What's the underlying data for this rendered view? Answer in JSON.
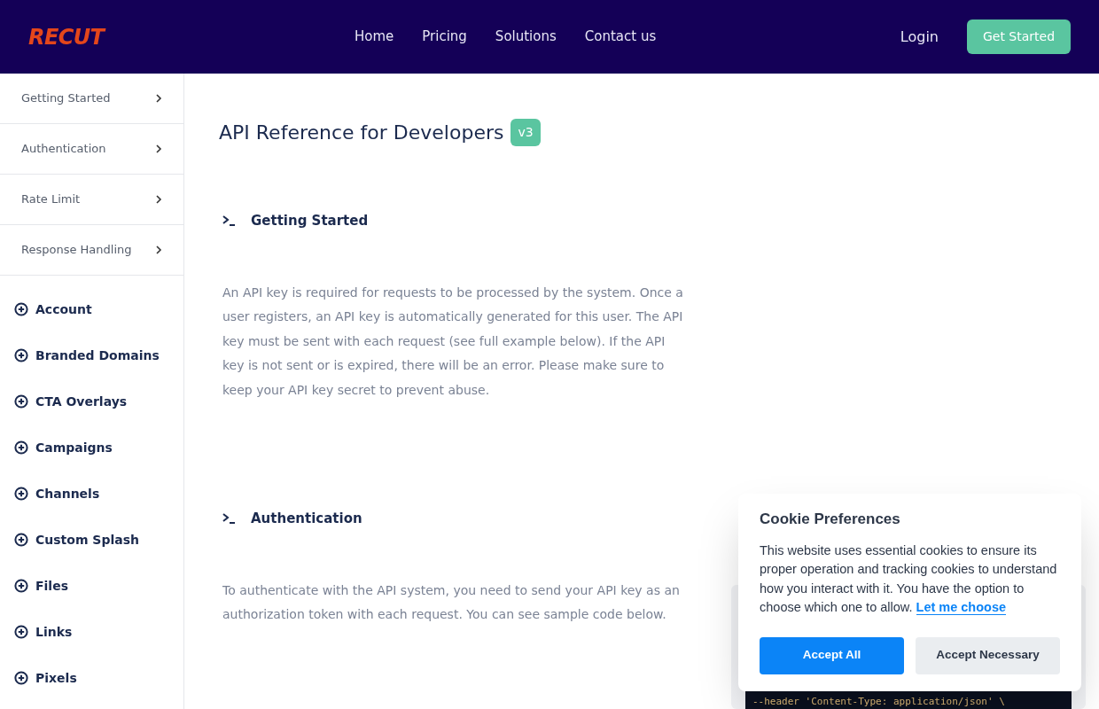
{
  "header": {
    "logo": "RECUT",
    "nav": [
      "Home",
      "Pricing",
      "Solutions",
      "Contact us"
    ],
    "login": "Login",
    "cta": "Get Started"
  },
  "sidebar": {
    "guides": [
      "Getting Started",
      "Authentication",
      "Rate Limit",
      "Response Handling"
    ],
    "sections": [
      "Account",
      "Branded Domains",
      "CTA Overlays",
      "Campaigns",
      "Channels",
      "Custom Splash",
      "Files",
      "Links",
      "Pixels"
    ]
  },
  "page": {
    "title": "API Reference for Developers",
    "badge": "v3",
    "sections": [
      {
        "heading": "Getting Started",
        "text": "An API key is required for requests to be processed by the system. Once a user registers, an API key is automatically generated for this user. The API key must be sent with each request (see full example below). If the API key is not sent or is expired, there will be an error. Please make sure to keep your API key secret to prevent abuse."
      },
      {
        "heading": "Authentication",
        "text": "To authenticate with the API system, you need to send your API key as an authorization token with each request. You can see sample code below."
      }
    ],
    "code": "--header 'Content-Type: application/json' \\"
  },
  "cookie": {
    "title": "Cookie Preferences",
    "text": "This website uses essential cookies to ensure its proper operation and tracking cookies to understand how you interact with it. You have the option to choose which one to allow.",
    "link": "Let me choose",
    "buttons": [
      "Accept All",
      "Accept Necessary"
    ]
  }
}
